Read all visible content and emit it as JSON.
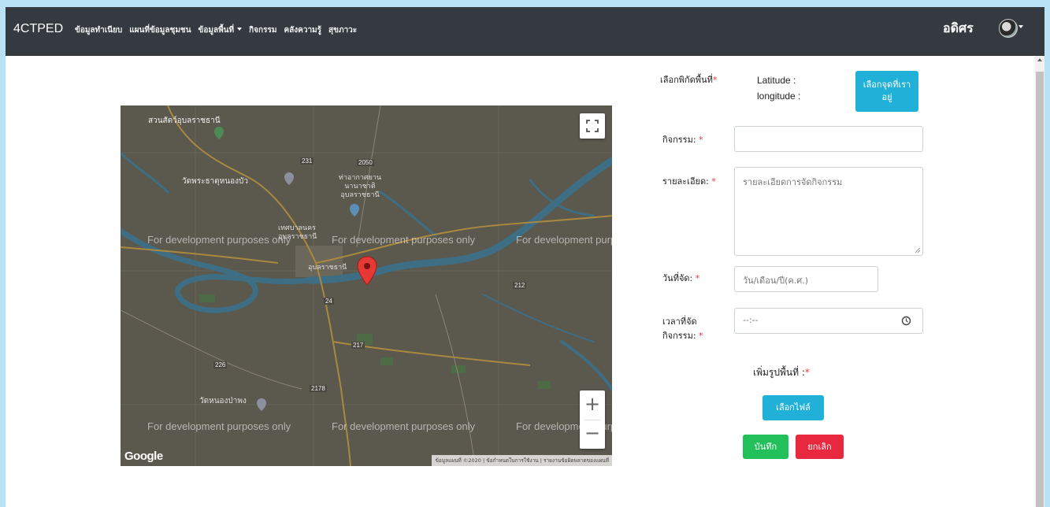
{
  "navbar": {
    "brand": "4CTPED",
    "items": [
      "ข้อมูลทำเนียบ",
      "แผนที่ข้อมูลชุมชน",
      "ข้อมูลพื้นที่",
      "กิจกรรม",
      "คลังความรู้",
      "สุขภาวะ"
    ],
    "user_name": "อดิศร"
  },
  "map": {
    "labels": [
      "สวนสัตว์อุบลราชธานี",
      "วัดพระธาตุหนองบัว",
      "ท่าอากาศยานนานาชาติอุบลราชธานี",
      "เทศบาลนครอุบลราชธานี",
      "อุบลราชธานี",
      "วัดหนองป่าพง"
    ],
    "watermark": "For development purposes only",
    "google": "Google",
    "attribution": "ข้อมูลแผนที่ ©2020 | ข้อกำหนดในการใช้งาน | รายงานข้อผิดพลาดของแผนที่",
    "road_numbers": [
      "231",
      "2050",
      "24",
      "217",
      "226",
      "2178",
      "212"
    ],
    "zoom_in": "+",
    "zoom_out": "−"
  },
  "form": {
    "location_label": "เลือกพิกัดพื้นที่",
    "latitude_label": "Latitude :",
    "longitude_label": "longitude :",
    "pick_location_button": "เลือกจุดที่เราอยู่",
    "activity_label": "กิจกรรม:",
    "activity_value": "",
    "detail_label": "รายละเอียด:",
    "detail_placeholder": "รายละเอียดการจัดกิจกรรม",
    "date_label": "วันที่จัด:",
    "date_placeholder": "วัน/เดือน/ปี(ค.ศ.)",
    "time_label": "เวลาที่จัดกิจกรรม:",
    "time_placeholder": "--:--",
    "image_label": "เพิ่มรูปพื้นที่ :",
    "choose_file_button": "เลือกไฟล์",
    "save_button": "บันทึก",
    "cancel_button": "ยกเลิก",
    "required_mark": "*"
  },
  "colors": {
    "navbar_bg": "#343a40",
    "info": "#21b1d8",
    "success": "#22c05a",
    "danger": "#e8283f",
    "map_bg": "#5b584e",
    "river": "#3e6e84"
  }
}
